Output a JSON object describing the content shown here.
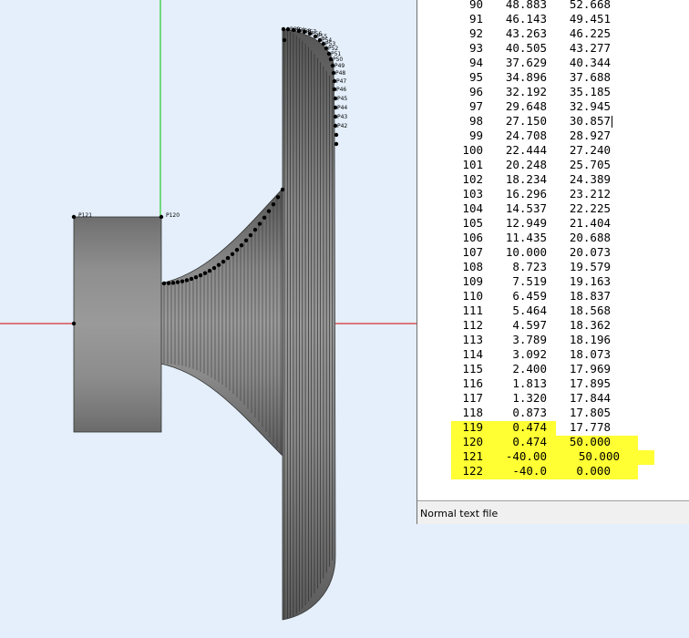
{
  "viewport": {
    "point_labels_top": [
      "P60",
      "P59",
      "P58",
      "P57",
      "P56",
      "P55",
      "P54",
      "P53",
      "P52",
      "P51",
      "P50",
      "P49",
      "P48",
      "P47",
      "P46",
      "P45",
      "P44",
      "P43",
      "P42"
    ],
    "point_label_p121": "P121",
    "point_label_p120": "P120",
    "colors": {
      "background": "#e4effb",
      "x_axis": "#d40000",
      "y_axis": "#00c000",
      "body": "#8c8c8c",
      "outline": "#333333"
    }
  },
  "editor": {
    "status_text": "Normal text file",
    "highlight_color": "#ffff33",
    "rows": [
      {
        "idx": "90",
        "x": "48.883",
        "y": "52.668"
      },
      {
        "idx": "91",
        "x": "46.143",
        "y": "49.451"
      },
      {
        "idx": "92",
        "x": "43.263",
        "y": "46.225"
      },
      {
        "idx": "93",
        "x": "40.505",
        "y": "43.277"
      },
      {
        "idx": "94",
        "x": "37.629",
        "y": "40.344"
      },
      {
        "idx": "95",
        "x": "34.896",
        "y": "37.688"
      },
      {
        "idx": "96",
        "x": "32.192",
        "y": "35.185"
      },
      {
        "idx": "97",
        "x": "29.648",
        "y": "32.945"
      },
      {
        "idx": "98",
        "x": "27.150",
        "y": "30.857"
      },
      {
        "idx": "99",
        "x": "24.708",
        "y": "28.927"
      },
      {
        "idx": "100",
        "x": "22.444",
        "y": "27.240"
      },
      {
        "idx": "101",
        "x": "20.248",
        "y": "25.705"
      },
      {
        "idx": "102",
        "x": "18.234",
        "y": "24.389"
      },
      {
        "idx": "103",
        "x": "16.296",
        "y": "23.212"
      },
      {
        "idx": "104",
        "x": "14.537",
        "y": "22.225"
      },
      {
        "idx": "105",
        "x": "12.949",
        "y": "21.404"
      },
      {
        "idx": "106",
        "x": "11.435",
        "y": "20.688"
      },
      {
        "idx": "107",
        "x": "10.000",
        "y": "20.073"
      },
      {
        "idx": "108",
        "x": "8.723",
        "y": "19.579"
      },
      {
        "idx": "109",
        "x": "7.519",
        "y": "19.163"
      },
      {
        "idx": "110",
        "x": "6.459",
        "y": "18.837"
      },
      {
        "idx": "111",
        "x": "5.464",
        "y": "18.568"
      },
      {
        "idx": "112",
        "x": "4.597",
        "y": "18.362"
      },
      {
        "idx": "113",
        "x": "3.789",
        "y": "18.196"
      },
      {
        "idx": "114",
        "x": "3.092",
        "y": "18.073"
      },
      {
        "idx": "115",
        "x": "2.400",
        "y": "17.969"
      },
      {
        "idx": "116",
        "x": "1.813",
        "y": "17.895"
      },
      {
        "idx": "117",
        "x": "1.320",
        "y": "17.844"
      },
      {
        "idx": "118",
        "x": "0.873",
        "y": "17.805"
      },
      {
        "idx": "119",
        "x": "0.474",
        "y": "17.778"
      },
      {
        "idx": "120",
        "x": "0.474",
        "y": "50.000"
      },
      {
        "idx": "121",
        "x": "-40.00",
        "y": "50.000"
      },
      {
        "idx": "122",
        "x": "-40.0",
        "y": "0.000"
      }
    ]
  }
}
